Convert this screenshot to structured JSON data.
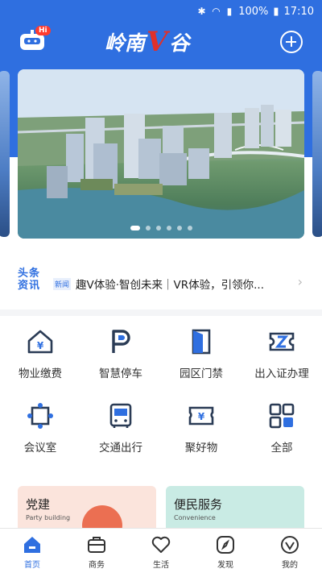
{
  "status_bar": {
    "battery": "100%",
    "time": "17:10",
    "signal_icons": "✱ ◠ ▮"
  },
  "header": {
    "hi_badge": "Hi",
    "logo_text_a": "岭南",
    "logo_text_v": "V",
    "logo_text_b": "谷"
  },
  "news": {
    "logo_line1": "头条",
    "logo_line2": "资讯",
    "tag": "新闻",
    "headline": "趣V体验·智创未来｜VR体验，引领你..."
  },
  "services": [
    {
      "label": "物业缴费",
      "icon": "house-yen-icon"
    },
    {
      "label": "智慧停车",
      "icon": "parking-icon"
    },
    {
      "label": "园区门禁",
      "icon": "door-icon"
    },
    {
      "label": "出入证办理",
      "icon": "pass-ticket-icon"
    },
    {
      "label": "会议室",
      "icon": "meeting-room-icon"
    },
    {
      "label": "交通出行",
      "icon": "bus-icon"
    },
    {
      "label": "聚好物",
      "icon": "shopping-icon"
    },
    {
      "label": "全部",
      "icon": "grid-all-icon"
    }
  ],
  "cards": {
    "party": {
      "title": "党建",
      "subtitle": "Party building"
    },
    "service": {
      "title": "便民服务",
      "subtitle": "Convenience"
    }
  },
  "tabs": [
    {
      "label": "首页",
      "icon": "home-icon"
    },
    {
      "label": "商务",
      "icon": "briefcase-icon"
    },
    {
      "label": "生活",
      "icon": "heart-icon"
    },
    {
      "label": "发现",
      "icon": "compass-icon"
    },
    {
      "label": "我的",
      "icon": "profile-icon"
    }
  ],
  "colors": {
    "primary": "#2f6fe0",
    "accent_red": "#e0302a"
  }
}
